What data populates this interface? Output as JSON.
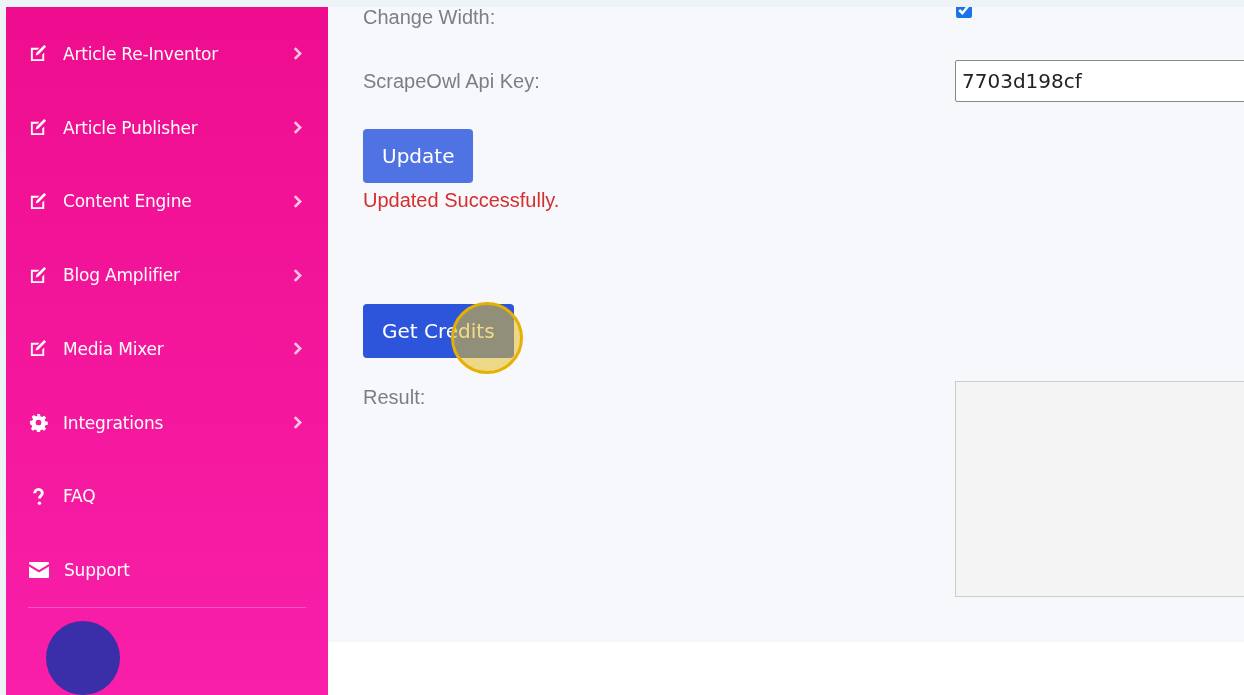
{
  "sidebar": {
    "items": [
      {
        "kind": "edit",
        "label": "Article Re-Inventor",
        "has_submenu": true
      },
      {
        "kind": "edit",
        "label": "Article Publisher",
        "has_submenu": true
      },
      {
        "kind": "edit",
        "label": "Content Engine",
        "has_submenu": true
      },
      {
        "kind": "edit",
        "label": "Blog Amplifier",
        "has_submenu": true
      },
      {
        "kind": "edit",
        "label": "Media Mixer",
        "has_submenu": true
      },
      {
        "kind": "gear",
        "label": "Integrations",
        "has_submenu": true
      },
      {
        "kind": "question",
        "label": "FAQ",
        "has_submenu": false
      },
      {
        "kind": "envelope",
        "label": "Support",
        "has_submenu": false
      }
    ]
  },
  "settings": {
    "change_width": {
      "label": "Change Width:",
      "checked": true
    },
    "api_key": {
      "label": "ScrapeOwl Api Key:",
      "value": "7703d198cf"
    },
    "update_button": "Update",
    "status_message": "Updated Successfully.",
    "credits_button": "Get Credits",
    "result_label": "Result:"
  }
}
